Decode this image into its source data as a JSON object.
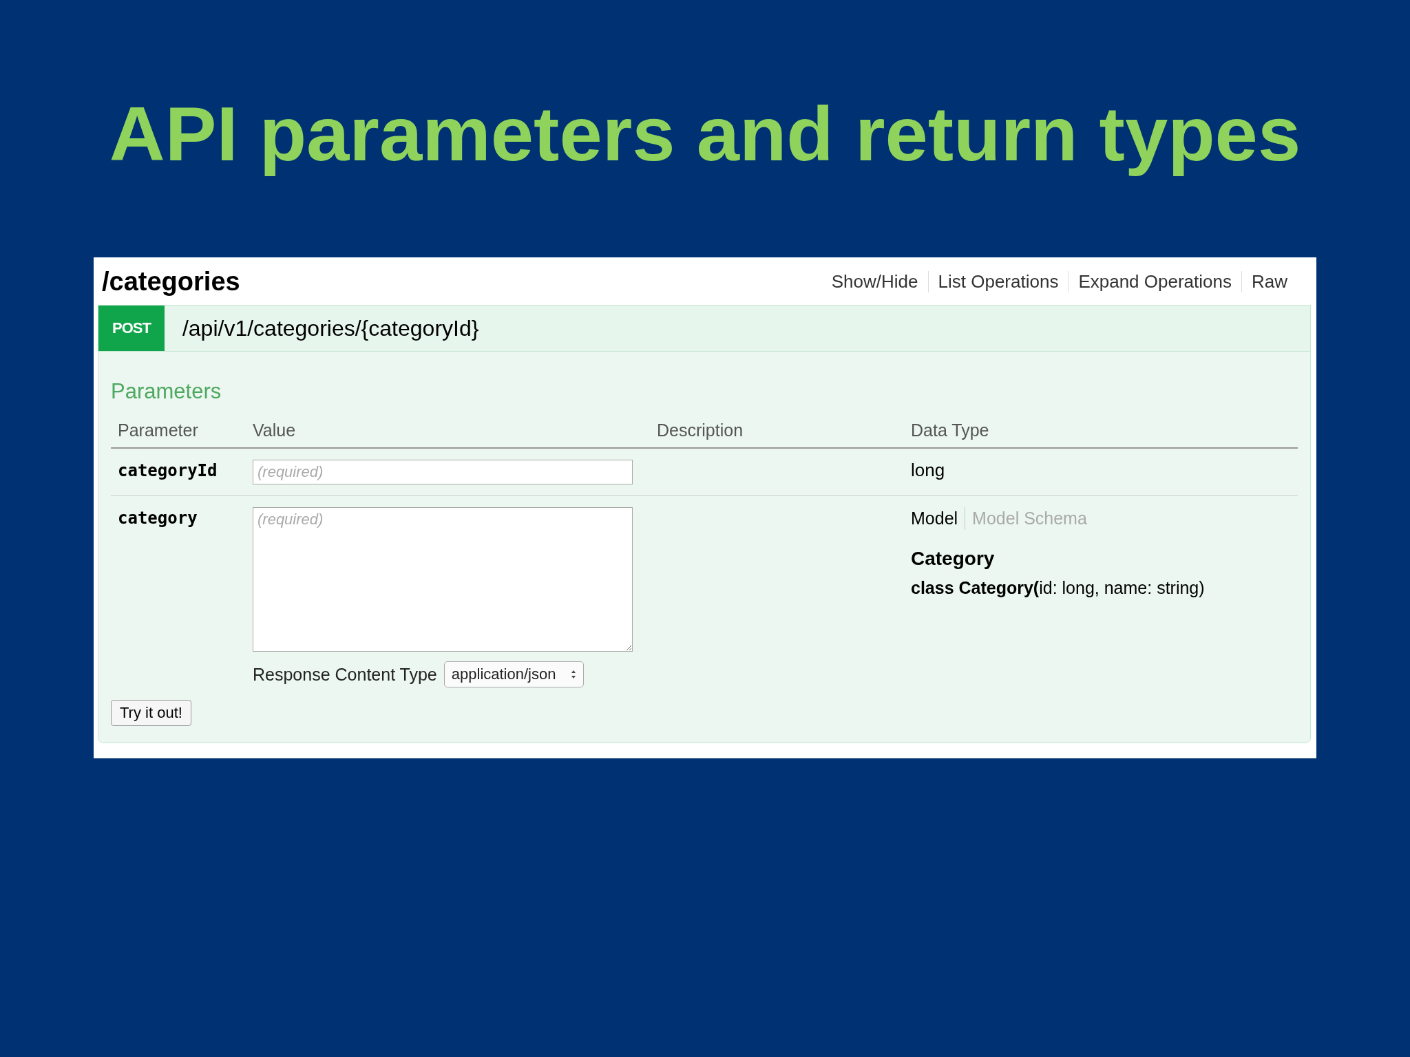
{
  "slide_title": "API parameters and return types",
  "resource": {
    "name": "/categories",
    "links": [
      "Show/Hide",
      "List Operations",
      "Expand Operations",
      "Raw"
    ]
  },
  "operation": {
    "method": "POST",
    "path": "/api/v1/categories/{categoryId}",
    "parameters_heading": "Parameters",
    "columns": [
      "Parameter",
      "Value",
      "Description",
      "Data Type"
    ],
    "parameters": [
      {
        "name": "categoryId",
        "kind": "input",
        "placeholder": "(required)",
        "data_type": "long"
      },
      {
        "name": "category",
        "kind": "textarea",
        "placeholder": "(required)",
        "model_tabs": [
          {
            "label": "Model",
            "selected": true
          },
          {
            "label": "Model Schema",
            "selected": false
          }
        ],
        "model_name": "Category",
        "model_description": "**class Category(**id: long, name: string)",
        "content_type_label": "Response Content Type",
        "content_type": "application/json"
      }
    ],
    "submit": "Try it out!"
  }
}
